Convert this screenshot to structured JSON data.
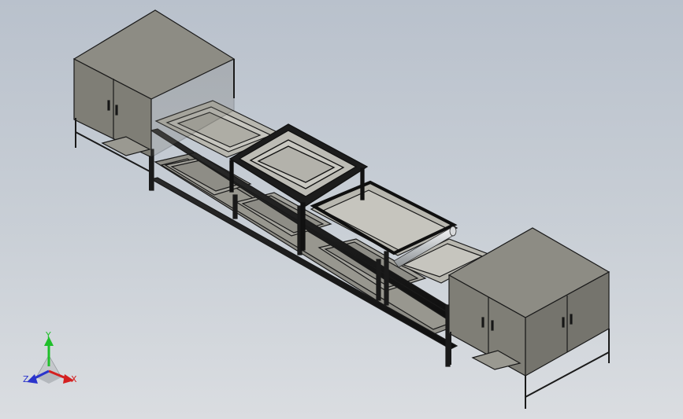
{
  "viewport": {
    "background_top": "#b9c1cc",
    "background_bottom": "#dadde1",
    "model_fill": "#8c8b82",
    "model_edge": "#222222"
  },
  "triad": {
    "x_label": "X",
    "y_label": "Y",
    "z_label": "Z",
    "x_color": "#d42020",
    "y_color": "#1fbf2a",
    "z_color": "#2a34cc"
  }
}
